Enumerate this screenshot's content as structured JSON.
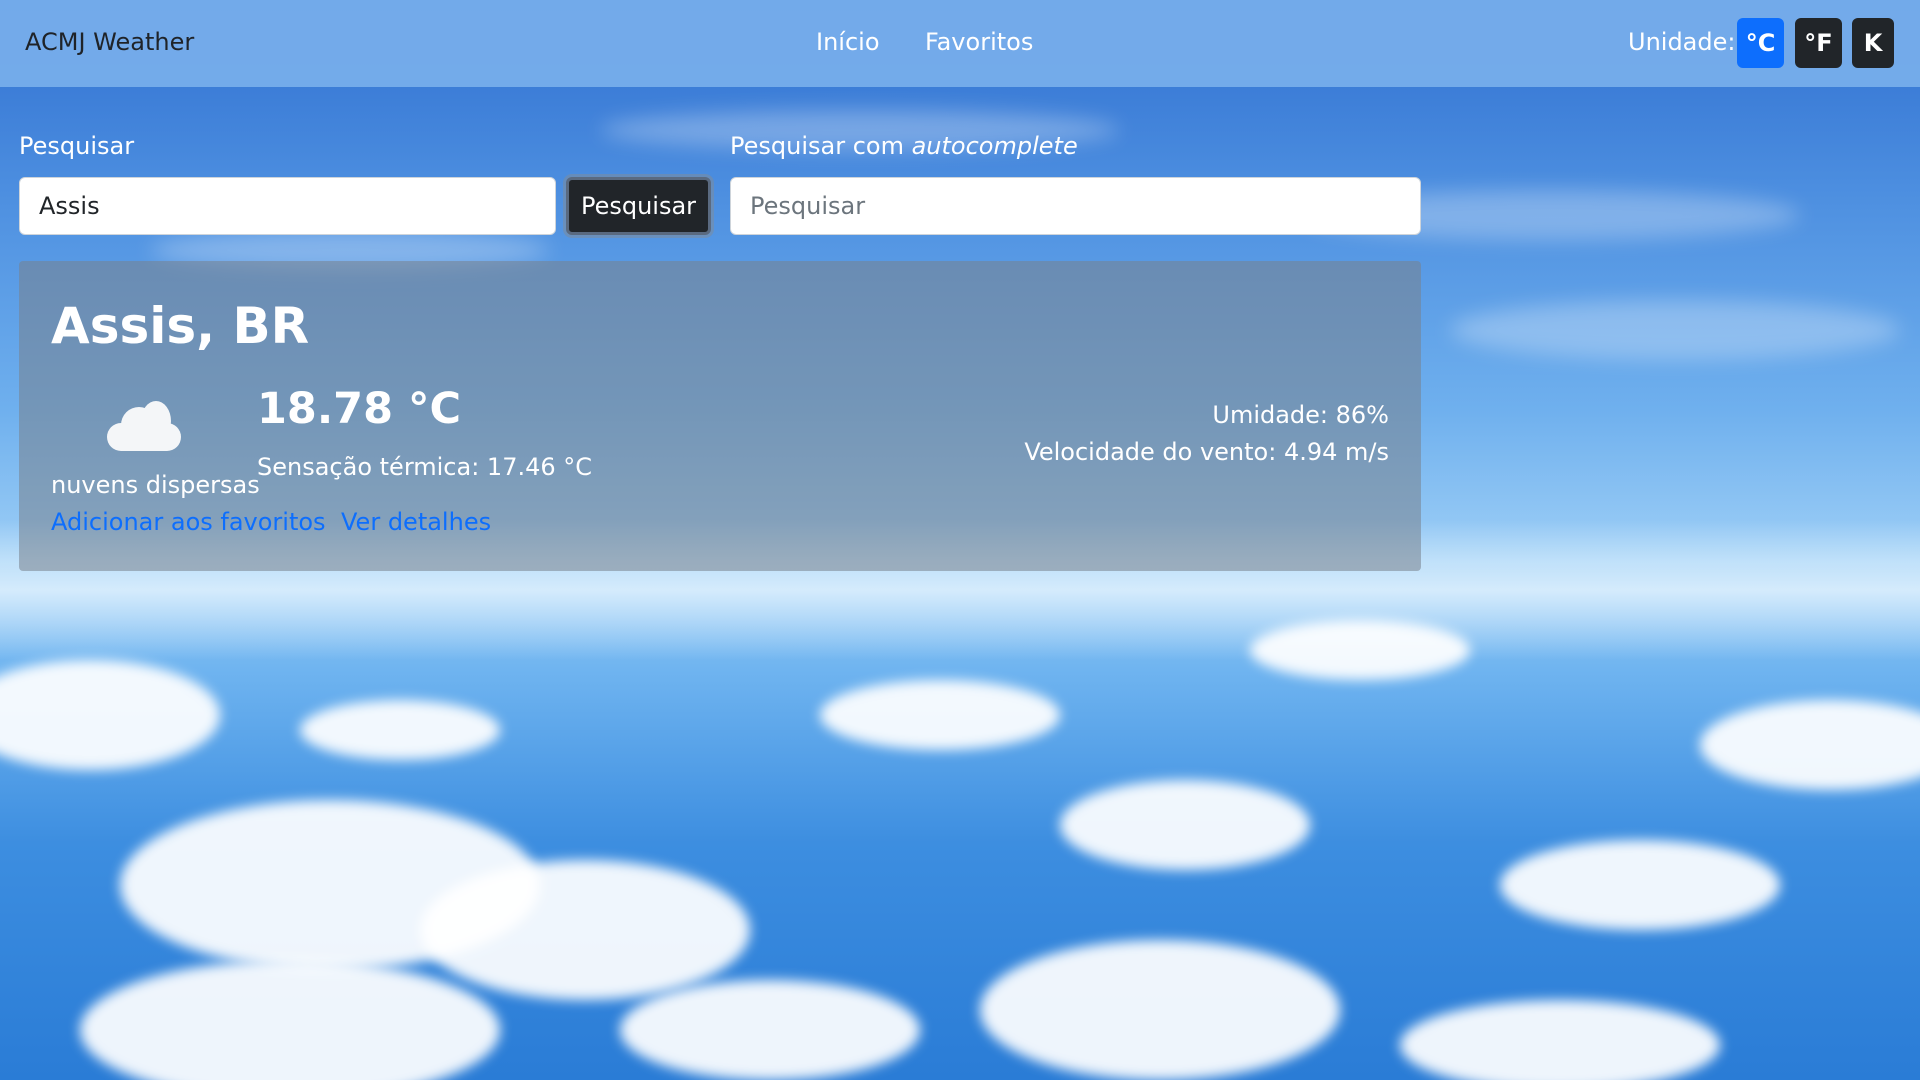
{
  "navbar": {
    "brand": "ACMJ Weather",
    "links": [
      "Início",
      "Favoritos"
    ],
    "unit_label": "Unidade:",
    "units": [
      "°C",
      "°F",
      "K"
    ],
    "active_unit": "°C"
  },
  "search": {
    "label": "Pesquisar",
    "value": "Assis",
    "button": "Pesquisar",
    "autocomplete_label_prefix": "Pesquisar com ",
    "autocomplete_label_em": "autocomplete",
    "autocomplete_placeholder": "Pesquisar"
  },
  "weather": {
    "city": "Assis, BR",
    "icon": "cloud-icon",
    "temperature": "18.78 °C",
    "description": "nuvens dispersas",
    "feels_like": "Sensação térmica: 17.46 °C",
    "humidity": "Umidade: 86%",
    "wind": "Velocidade do vento: 4.94 m/s",
    "add_favorite": "Adicionar aos favoritos",
    "details": "Ver detalhes"
  },
  "colors": {
    "navbar_bg": "#78afeb",
    "active_unit_bg": "#0d6efd",
    "inactive_unit_bg": "#212529",
    "link": "#0d6efd",
    "card_bg": "#78828c"
  }
}
